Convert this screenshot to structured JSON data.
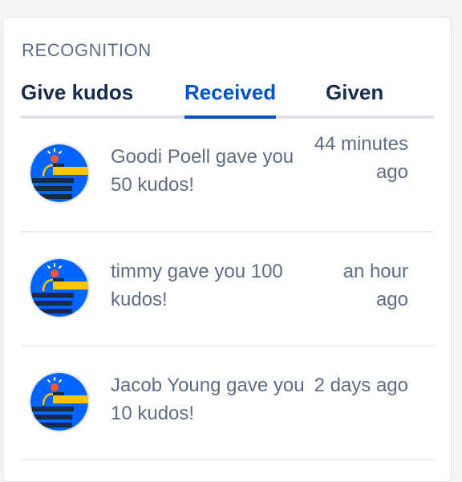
{
  "widget": {
    "title": "RECOGNITION"
  },
  "tabs": [
    {
      "label": "Give kudos",
      "active": false
    },
    {
      "label": "Received",
      "active": true
    },
    {
      "label": "Given",
      "active": false
    }
  ],
  "kudos": [
    {
      "message": "Goodi Poell gave you 50 kudos!",
      "time": "44 minutes ago",
      "avatar_icon": "kudos-badge-icon"
    },
    {
      "message": "timmy gave you 100 kudos!",
      "time": "an hour ago",
      "avatar_icon": "kudos-badge-icon"
    },
    {
      "message": "Jacob Young gave you 10 kudos!",
      "time": "2 days ago",
      "avatar_icon": "kudos-badge-icon"
    }
  ],
  "colors": {
    "accent": "#0052cc",
    "avatar_bg": "#0065ff",
    "avatar_orange": "#ff5630",
    "avatar_yellow": "#ffc400",
    "avatar_navy": "#172b4d"
  }
}
